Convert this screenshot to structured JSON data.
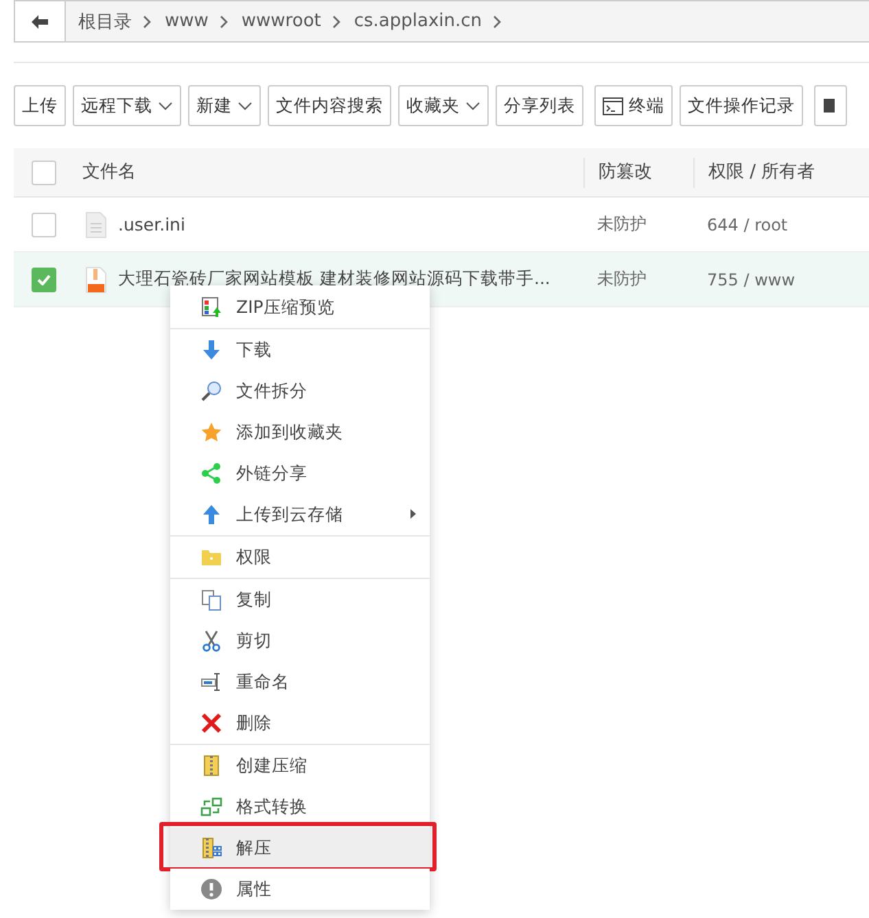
{
  "breadcrumb": {
    "items": [
      "根目录",
      "www",
      "wwwroot",
      "cs.applaxin.cn"
    ]
  },
  "toolbar": [
    {
      "label": "上传",
      "kind": "text"
    },
    {
      "label": "远程下载",
      "kind": "dropdown"
    },
    {
      "label": "新建",
      "kind": "dropdown"
    },
    {
      "label": "文件内容搜索",
      "kind": "text"
    },
    {
      "label": "收藏夹",
      "kind": "dropdown"
    },
    {
      "label": "分享列表",
      "kind": "text"
    },
    {
      "label": "终端",
      "kind": "terminal"
    },
    {
      "label": "文件操作记录",
      "kind": "text"
    },
    {
      "kind": "cut"
    }
  ],
  "table": {
    "columns": [
      "文件名",
      "防篡改",
      "权限 / 所有者"
    ],
    "all_checked": false,
    "rows": [
      {
        "name": ".user.ini",
        "kind": "file",
        "protection": "未防护",
        "permission": "644 / root",
        "selected": false
      },
      {
        "name": "大理石瓷砖厂家网站模板 建材装修网站源码下载带手...",
        "kind": "zip",
        "protection": "未防护",
        "permission": "755 / www",
        "selected": true
      }
    ]
  },
  "context_menu": {
    "groups": [
      [
        {
          "label": "ZIP压缩预览",
          "kind": "preview",
          "submenu": false,
          "selected": false
        }
      ],
      [
        {
          "label": "下载",
          "kind": "down",
          "submenu": false,
          "selected": false
        },
        {
          "label": "文件拆分",
          "kind": "split",
          "submenu": false,
          "selected": false
        },
        {
          "label": "添加到收藏夹",
          "kind": "star",
          "submenu": false,
          "selected": false
        },
        {
          "label": "外链分享",
          "kind": "share",
          "submenu": false,
          "selected": false
        },
        {
          "label": "上传到云存储",
          "kind": "up",
          "submenu": true,
          "selected": false
        }
      ],
      [
        {
          "label": "权限",
          "kind": "folder",
          "submenu": false,
          "selected": false
        }
      ],
      [
        {
          "label": "复制",
          "kind": "copy",
          "submenu": false,
          "selected": false
        },
        {
          "label": "剪切",
          "kind": "cut",
          "submenu": false,
          "selected": false
        },
        {
          "label": "重命名",
          "kind": "rename",
          "submenu": false,
          "selected": false
        },
        {
          "label": "删除",
          "kind": "delete",
          "submenu": false,
          "selected": false
        }
      ],
      [
        {
          "label": "创建压缩",
          "kind": "zip",
          "submenu": false,
          "selected": false
        },
        {
          "label": "格式转换",
          "kind": "convert",
          "submenu": false,
          "selected": false
        },
        {
          "label": "解压",
          "kind": "unzip",
          "submenu": false,
          "selected": true
        },
        {
          "label": "属性",
          "kind": "info",
          "submenu": false,
          "selected": false
        }
      ]
    ]
  }
}
